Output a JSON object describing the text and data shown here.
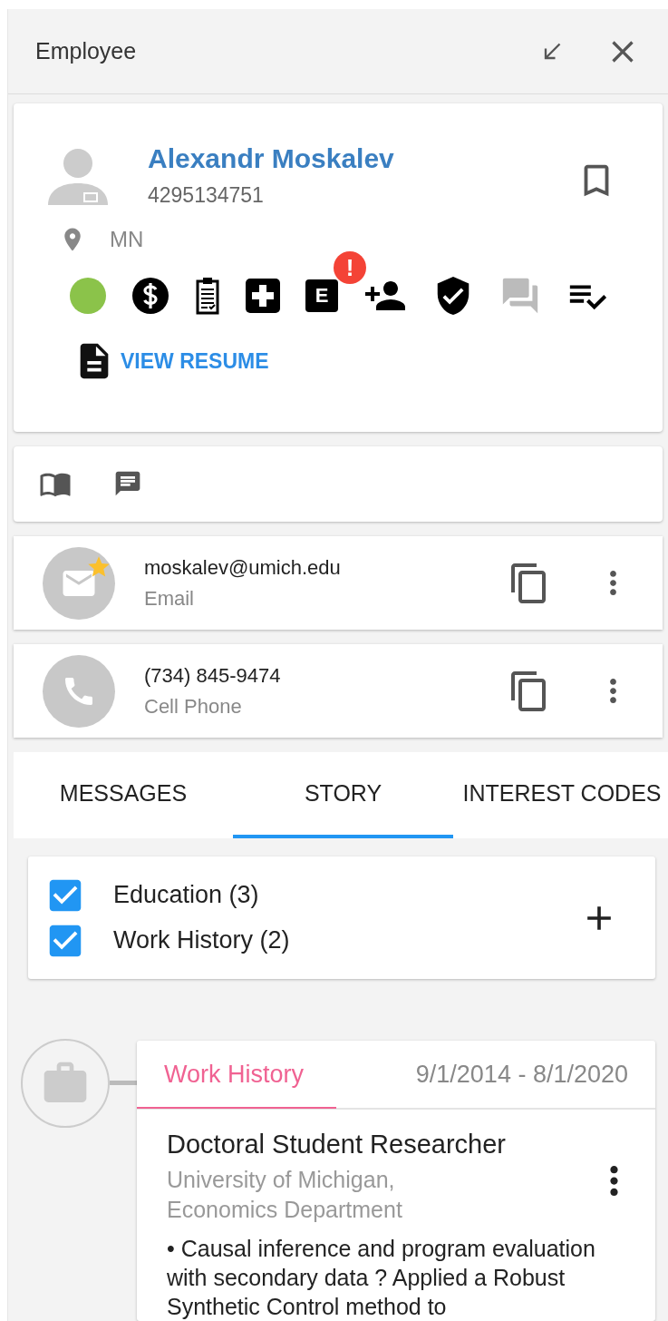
{
  "window": {
    "title": "Employee"
  },
  "profile": {
    "name": "Alexandr Moskalev",
    "id_number": "4295134751",
    "location": "MN",
    "bookmarked": false,
    "status_icons": [
      {
        "kind": "dot",
        "color": "#8bc34a"
      },
      {
        "kind": "dollar",
        "active": true
      },
      {
        "kind": "clipboard",
        "active": true
      },
      {
        "kind": "medical",
        "active": true
      },
      {
        "kind": "letter",
        "letter": "E",
        "active": true,
        "alert": "!"
      },
      {
        "kind": "person-add",
        "active": true
      },
      {
        "kind": "shield",
        "active": true
      },
      {
        "kind": "chat",
        "active": false
      },
      {
        "kind": "checklist",
        "active": true
      }
    ],
    "resume_link": "VIEW RESUME"
  },
  "contacts": [
    {
      "kind": "email",
      "value": "moskalev@umich.edu",
      "label": "Email",
      "favorite": true
    },
    {
      "kind": "phone",
      "value": "(734) 845-9474",
      "label": "Cell Phone",
      "favorite": false
    }
  ],
  "tabs": [
    {
      "label": "MESSAGES",
      "selected": false
    },
    {
      "label": "STORY",
      "selected": true
    },
    {
      "label": "INTEREST CODES",
      "selected": false
    }
  ],
  "filters": [
    {
      "label": "Education (3)",
      "checked": true
    },
    {
      "label": "Work History (2)",
      "checked": true
    }
  ],
  "timeline": [
    {
      "kind": "work",
      "category": "Work History",
      "dates": "9/1/2014 - 8/1/2020",
      "title": "Doctoral Student Researcher",
      "organization": "University of Michigan, Economics Department",
      "description": "• Causal inference and program evaluation with secondary data ? Applied a Robust Synthetic Control method to"
    }
  ]
}
